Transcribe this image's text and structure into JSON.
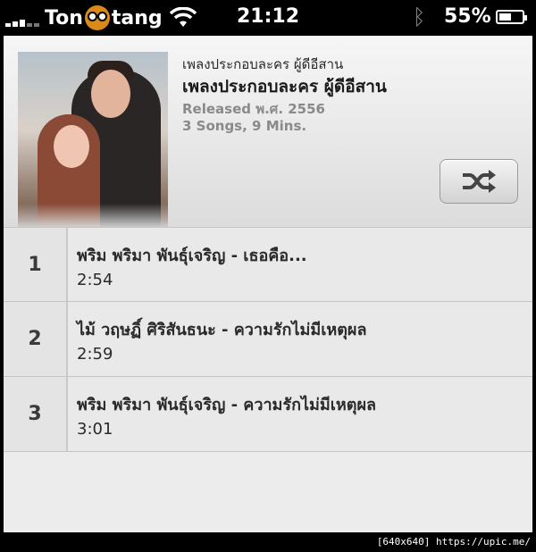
{
  "status_bar": {
    "carrier_left": "Ton",
    "carrier_right": "tang",
    "time": "21:12",
    "battery_percent": "55%",
    "battery_level": 0.55,
    "icons": [
      "signal-icon",
      "carrier-logo-icon",
      "wifi-icon",
      "bluetooth-icon",
      "battery-icon"
    ]
  },
  "album": {
    "subtitle": "เพลงประกอบละคร ผู้ดีอีสาน",
    "title": "เพลงประกอบละคร ผู้ดีอีสาน",
    "released": "Released พ.ศ. 2556",
    "counts": "3 Songs, 9 Mins.",
    "shuffle_icon": "shuffle-icon"
  },
  "tracks": [
    {
      "number": "1",
      "title": "พริม พริมา พันธุ์เจริญ - เธอคือ...",
      "duration": "2:54"
    },
    {
      "number": "2",
      "title": "ไม้ วฤษฏิ์ ศิริสันธนะ - ความรักไม่มีเหตุผล",
      "duration": "2:59"
    },
    {
      "number": "3",
      "title": "พริม พริมา พันธุ์เจริญ - ความรักไม่มีเหตุผล",
      "duration": "3:01"
    }
  ],
  "watermark": "[640x640] https://upic.me/"
}
